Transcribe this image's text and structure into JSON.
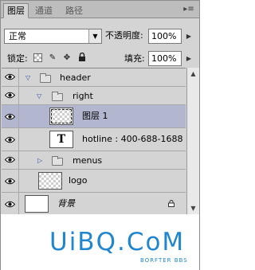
{
  "tabs": [
    {
      "label": "图层",
      "active": true
    },
    {
      "label": "通道",
      "active": false
    },
    {
      "label": "路径",
      "active": false
    }
  ],
  "blend": {
    "mode": "正常"
  },
  "opacity": {
    "label": "不透明度:",
    "value": "100%"
  },
  "lock": {
    "label": "锁定:"
  },
  "fill": {
    "label": "填充:",
    "value": "100%"
  },
  "layers": [
    {
      "name": "header",
      "kind": "group",
      "expanded": true,
      "indent": 0
    },
    {
      "name": "right",
      "kind": "group",
      "expanded": true,
      "indent": 1
    },
    {
      "name": "图层 1",
      "kind": "pixel",
      "selected": true,
      "indent": 2
    },
    {
      "name": "hotline : 400-688-1688",
      "kind": "text",
      "indent": 2
    },
    {
      "name": "menus",
      "kind": "group",
      "expanded": false,
      "indent": 1
    },
    {
      "name": "logo",
      "kind": "pixel",
      "indent": 0
    },
    {
      "name": "背景",
      "kind": "background",
      "locked": true,
      "indent": 0
    }
  ],
  "watermark": {
    "main": "UiBQ.CoM",
    "sub": "BORFTER BBS"
  },
  "colors": {
    "panel": "#d4d4d4",
    "selected_row": "#b2b7cf",
    "watermark": "#1f86cf"
  }
}
